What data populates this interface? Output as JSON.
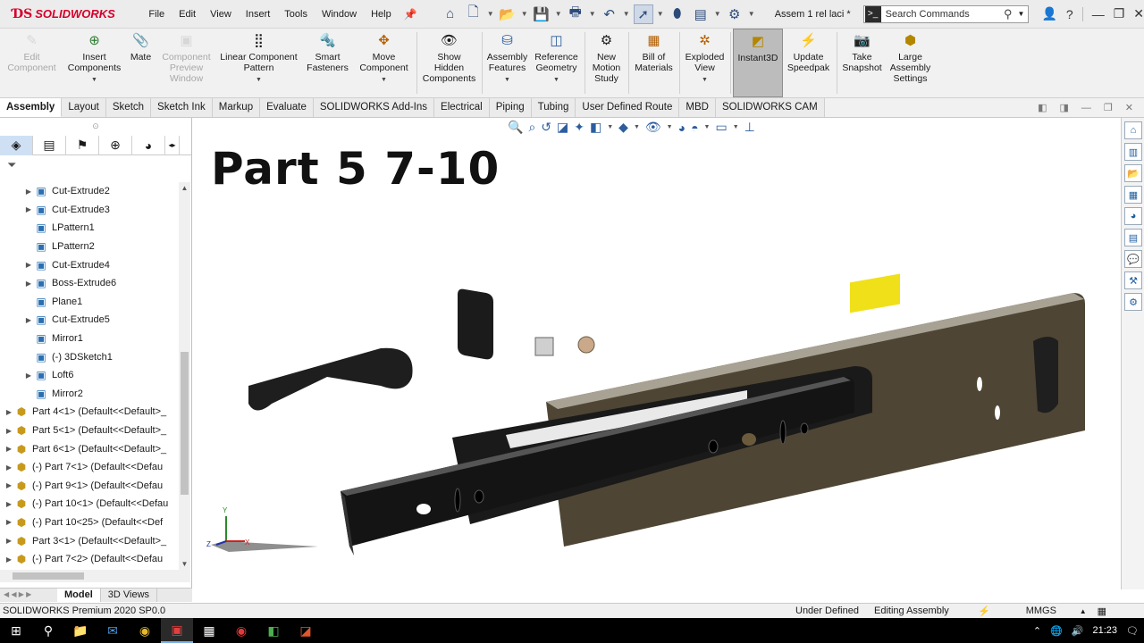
{
  "app": {
    "brand": "SOLIDWORKS",
    "document_title": "Assem 1 rel laci *"
  },
  "menu": [
    "File",
    "Edit",
    "View",
    "Insert",
    "Tools",
    "Window",
    "Help"
  ],
  "search": {
    "placeholder": "Search Commands"
  },
  "ribbon": [
    {
      "label": "Edit Component",
      "icon": "edit-component-icon",
      "enabled": false
    },
    {
      "label": "Insert Components",
      "icon": "insert-components-icon",
      "enabled": true,
      "dropdown": true
    },
    {
      "label": "Mate",
      "icon": "mate-icon",
      "enabled": true
    },
    {
      "label": "Component Preview Window",
      "icon": "component-preview-icon",
      "enabled": false
    },
    {
      "label": "Linear Component Pattern",
      "icon": "linear-pattern-icon",
      "enabled": true,
      "dropdown": true
    },
    {
      "label": "Smart Fasteners",
      "icon": "smart-fasteners-icon",
      "enabled": true
    },
    {
      "label": "Move Component",
      "icon": "move-component-icon",
      "enabled": true,
      "dropdown": true
    },
    {
      "label": "Show Hidden Components",
      "icon": "show-hidden-icon",
      "enabled": true
    },
    {
      "label": "Assembly Features",
      "icon": "assembly-features-icon",
      "enabled": true,
      "dropdown": true
    },
    {
      "label": "Reference Geometry",
      "icon": "reference-geometry-icon",
      "enabled": true,
      "dropdown": true
    },
    {
      "label": "New Motion Study",
      "icon": "motion-study-icon",
      "enabled": true
    },
    {
      "label": "Bill of Materials",
      "icon": "bom-icon",
      "enabled": true
    },
    {
      "label": "Exploded View",
      "icon": "exploded-view-icon",
      "enabled": true,
      "dropdown": true
    },
    {
      "label": "Instant3D",
      "icon": "instant3d-icon",
      "enabled": true,
      "active": true
    },
    {
      "label": "Update Speedpak",
      "icon": "speedpak-icon",
      "enabled": true
    },
    {
      "label": "Take Snapshot",
      "icon": "snapshot-icon",
      "enabled": true
    },
    {
      "label": "Large Assembly Settings",
      "icon": "large-assembly-icon",
      "enabled": true
    }
  ],
  "tabs": [
    "Assembly",
    "Layout",
    "Sketch",
    "Sketch Ink",
    "Markup",
    "Evaluate",
    "SOLIDWORKS Add-Ins",
    "Electrical",
    "Piping",
    "Tubing",
    "User Defined Route",
    "MBD",
    "SOLIDWORKS CAM"
  ],
  "active_tab": "Assembly",
  "tree": [
    {
      "label": "Cut-Extrude2",
      "type": "sub",
      "expandable": true
    },
    {
      "label": "Cut-Extrude3",
      "type": "sub",
      "expandable": true
    },
    {
      "label": "LPattern1",
      "type": "sub",
      "expandable": false
    },
    {
      "label": "LPattern2",
      "type": "sub",
      "expandable": false
    },
    {
      "label": "Cut-Extrude4",
      "type": "sub",
      "expandable": true
    },
    {
      "label": "Boss-Extrude6",
      "type": "sub",
      "expandable": true
    },
    {
      "label": "Plane1",
      "type": "sub",
      "expandable": false
    },
    {
      "label": "Cut-Extrude5",
      "type": "sub",
      "expandable": true
    },
    {
      "label": "Mirror1",
      "type": "sub",
      "expandable": false
    },
    {
      "label": "(-) 3DSketch1",
      "type": "sub",
      "expandable": false
    },
    {
      "label": "Loft6",
      "type": "sub",
      "expandable": true
    },
    {
      "label": "Mirror2",
      "type": "sub",
      "expandable": false
    },
    {
      "label": "Part 4<1> (Default<<Default>_",
      "type": "part",
      "expandable": true
    },
    {
      "label": "Part 5<1> (Default<<Default>_",
      "type": "part",
      "expandable": true
    },
    {
      "label": "Part 6<1> (Default<<Default>_",
      "type": "part",
      "expandable": true
    },
    {
      "label": "(-) Part 7<1> (Default<<Defau",
      "type": "part",
      "expandable": true
    },
    {
      "label": "(-) Part 9<1> (Default<<Defau",
      "type": "part",
      "expandable": true
    },
    {
      "label": "(-) Part 10<1> (Default<<Defau",
      "type": "part",
      "expandable": true
    },
    {
      "label": "(-) Part 10<25> (Default<<Def",
      "type": "part",
      "expandable": true
    },
    {
      "label": "Part 3<1> (Default<<Default>_",
      "type": "part",
      "expandable": true
    },
    {
      "label": "(-) Part 7<2> (Default<<Defau",
      "type": "part",
      "expandable": true
    }
  ],
  "fm_bottom_tabs": [
    "Model",
    "3D Views"
  ],
  "viewport": {
    "overlay_title": "Part 5 7-10"
  },
  "triad": {
    "x": "X",
    "y": "Y",
    "z": "Z"
  },
  "status": {
    "product": "SOLIDWORKS Premium 2020 SP0.0",
    "definition": "Under Defined",
    "mode": "Editing Assembly",
    "units": "MMGS"
  },
  "taskbar": {
    "time": "21:23"
  },
  "colors": {
    "brand_red": "#d6002a",
    "accent_blue": "#1e6fd9",
    "slide_yellow": "#f0e01a"
  }
}
